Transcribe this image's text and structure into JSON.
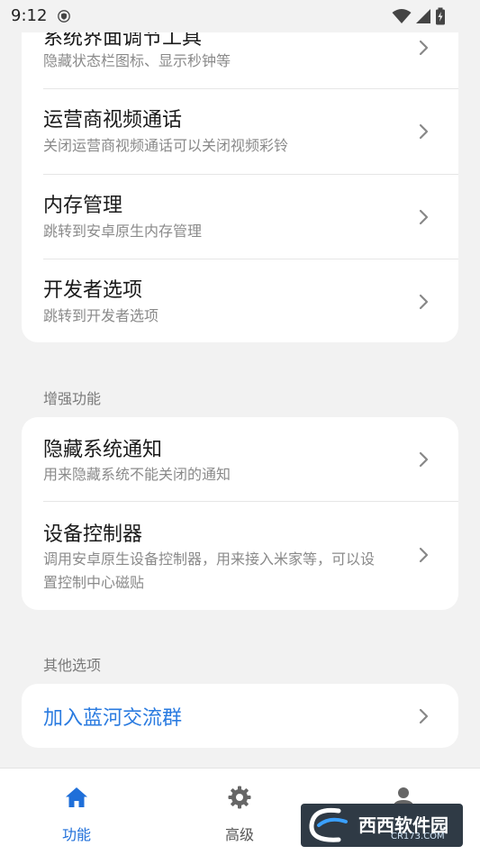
{
  "status_bar": {
    "time": "9:12"
  },
  "card_tools": {
    "items": [
      {
        "title": "系统界面调节工具",
        "subtitle": "隐藏状态栏图标、显示秒钟等"
      },
      {
        "title": "运营商视频通话",
        "subtitle": "关闭运营商视频通话可以关闭视频彩铃"
      },
      {
        "title": "内存管理",
        "subtitle": "跳转到安卓原生内存管理"
      },
      {
        "title": "开发者选项",
        "subtitle": "跳转到开发者选项"
      }
    ]
  },
  "section_enhance": {
    "header": "增强功能",
    "items": [
      {
        "title": "隐藏系统通知",
        "subtitle": "用来隐藏系统不能关闭的通知"
      },
      {
        "title": "设备控制器",
        "subtitle": "调用安卓原生设备控制器，用来接入米家等，可以设置控制中心磁贴"
      }
    ]
  },
  "section_other": {
    "header": "其他选项",
    "items": [
      {
        "title": "加入蓝河交流群"
      }
    ]
  },
  "nav": {
    "items": [
      {
        "label": "功能",
        "icon": "home-icon",
        "active": true
      },
      {
        "label": "高级",
        "icon": "gear-icon",
        "active": false
      },
      {
        "label": "",
        "icon": "person-icon",
        "active": false
      }
    ]
  },
  "colors": {
    "accent": "#1f6fd9",
    "link": "#2a7be0",
    "background": "#f2f2f2",
    "card": "#ffffff"
  },
  "watermark": {
    "text": "西西软件园",
    "sub": "CR173.COM"
  }
}
